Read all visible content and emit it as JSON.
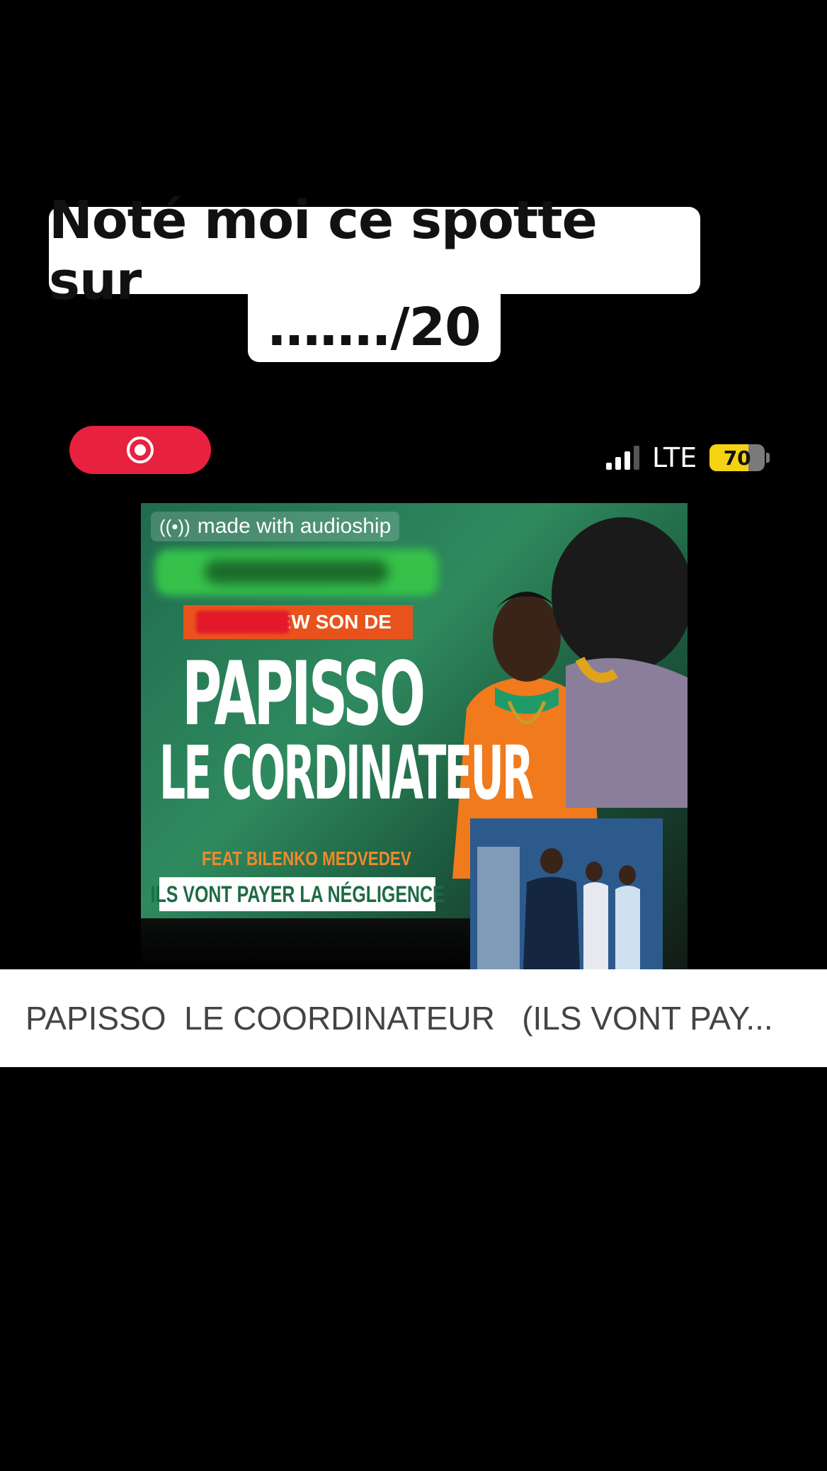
{
  "caption": {
    "line1": "Noté moi ce spotte sur",
    "line2": "……./20"
  },
  "record_button": {
    "icon": "record-icon"
  },
  "status_bar": {
    "signal_icon": "signal-bars-icon",
    "network": "LTE",
    "battery_percent": "70",
    "battery_level": 0.7
  },
  "cover": {
    "watermark": "made with audioship",
    "watermark_icon": "broadcast-icon",
    "tag_line": "NEW SON DE",
    "title_line1": "PAPISSO",
    "title_line2": "LE CORDINATEUR",
    "feat_line": "FEAT BILENKO MEDVEDEV",
    "slogan": "ILS VONT PAYER LA NÉGLIGENCE"
  },
  "track": {
    "title": "PAPISSO  LE COORDINATEUR   (ILS VONT PAY..."
  },
  "colors": {
    "background": "#000000",
    "record": "#e8213f",
    "battery": "#f5d313",
    "cover_green": "#2f8a5e",
    "tag_orange": "#e8531c"
  }
}
